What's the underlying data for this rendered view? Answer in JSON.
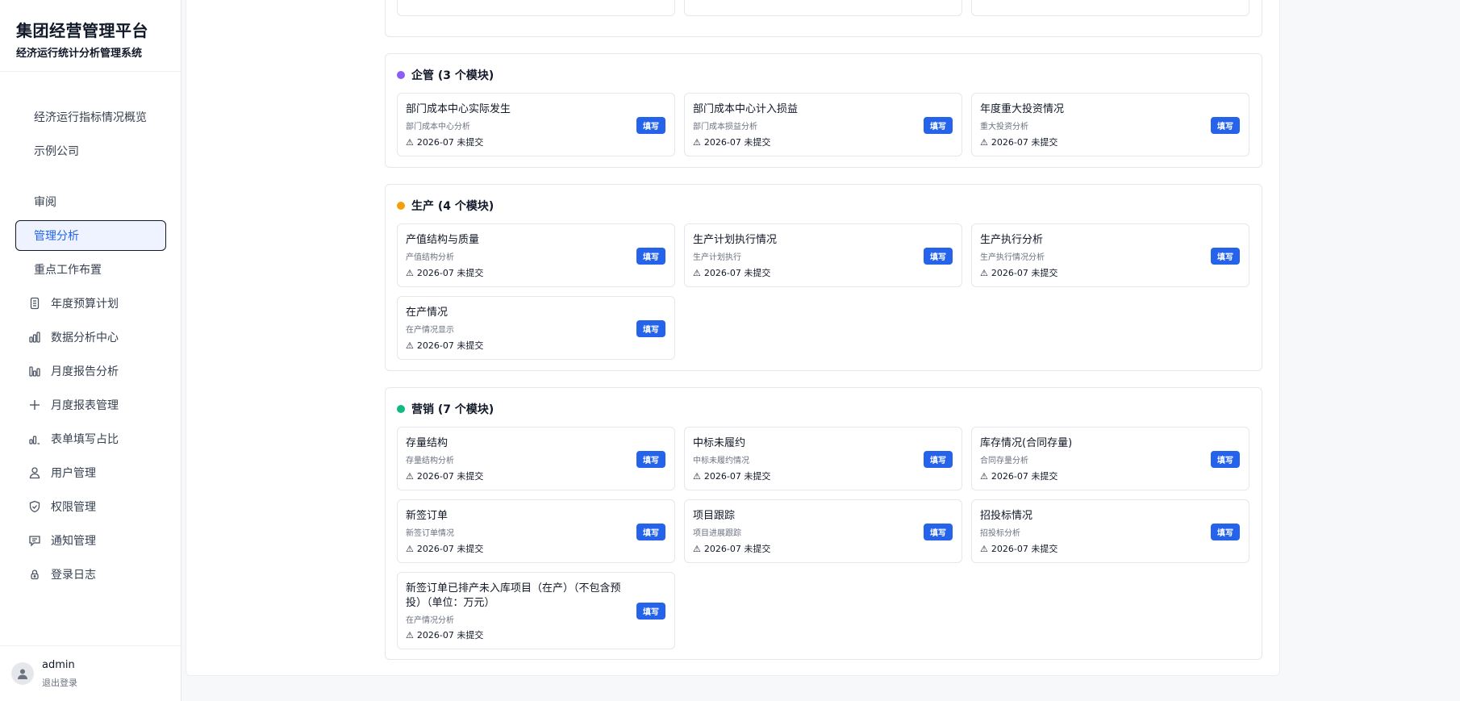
{
  "app": {
    "title": "集团经营管理平台",
    "subtitle": "经济运行统计分析管理系统"
  },
  "nav": {
    "items": [
      {
        "label": "经济运行指标情况概览",
        "icon": ""
      },
      {
        "label": "示例公司",
        "icon": ""
      },
      {
        "label": "审阅",
        "icon": ""
      },
      {
        "label": "管理分析",
        "icon": "",
        "active": true
      },
      {
        "label": "重点工作布置",
        "icon": ""
      },
      {
        "label": "年度预算计划",
        "icon": "document-icon"
      },
      {
        "label": "数据分析中心",
        "icon": "bar-chart-icon"
      },
      {
        "label": "月度报告分析",
        "icon": "report-chart-icon"
      },
      {
        "label": "月度报表管理",
        "icon": "plus-icon"
      },
      {
        "label": "表单填写占比",
        "icon": "ratio-chart-icon"
      },
      {
        "label": "用户管理",
        "icon": "users-icon"
      },
      {
        "label": "权限管理",
        "icon": "shield-icon"
      },
      {
        "label": "通知管理",
        "icon": "message-icon"
      },
      {
        "label": "登录日志",
        "icon": "lock-icon"
      }
    ]
  },
  "user": {
    "name": "admin",
    "logout": "退出登录"
  },
  "common": {
    "fill_label": "填写",
    "status_text": "2026-07 未提交",
    "status_icon": "warning-icon"
  },
  "sections": [
    {
      "name": "top-partial",
      "title": "",
      "color": "",
      "cards": [
        {},
        {},
        {}
      ]
    },
    {
      "name": "qiguan",
      "title": "企管 (3 个模块)",
      "color": "#8b5cf6",
      "cards": [
        {
          "title": "部门成本中心实际发生",
          "sub": "部门成本中心分析"
        },
        {
          "title": "部门成本中心计入损益",
          "sub": "部门成本损益分析"
        },
        {
          "title": "年度重大投资情况",
          "sub": "重大投资分析"
        }
      ]
    },
    {
      "name": "shengchan",
      "title": "生产 (4 个模块)",
      "color": "#f59e0b",
      "cards": [
        {
          "title": "产值结构与质量",
          "sub": "产值结构分析"
        },
        {
          "title": "生产计划执行情况",
          "sub": "生产计划执行"
        },
        {
          "title": "生产执行分析",
          "sub": "生产执行情况分析"
        },
        {
          "title": "在产情况",
          "sub": "在产情况显示"
        }
      ]
    },
    {
      "name": "yingxiao",
      "title": "营销 (7 个模块)",
      "color": "#10b981",
      "cards": [
        {
          "title": "存量结构",
          "sub": "存量结构分析"
        },
        {
          "title": "中标未履约",
          "sub": "中标未履约情况"
        },
        {
          "title": "库存情况(合同存量)",
          "sub": "合同存量分析"
        },
        {
          "title": "新签订单",
          "sub": "新签订单情况"
        },
        {
          "title": "项目跟踪",
          "sub": "项目进展跟踪"
        },
        {
          "title": "招投标情况",
          "sub": "招投标分析"
        },
        {
          "title": "新签订单已排产未入库项目（在产）（不包含预投）（单位：万元）",
          "sub": "在产情况分析"
        }
      ]
    }
  ]
}
